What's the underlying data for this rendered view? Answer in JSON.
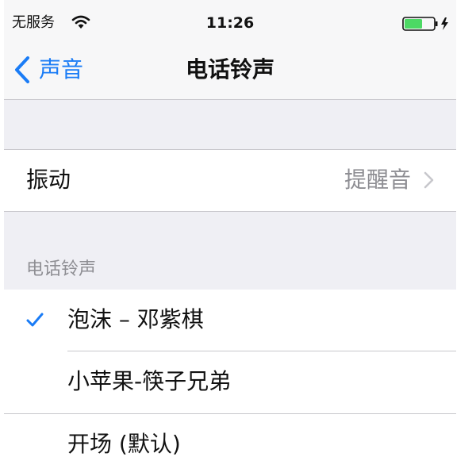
{
  "status_bar": {
    "carrier": "无服务",
    "time": "11:26",
    "icons": [
      "wifi-icon",
      "battery-charging-icon"
    ],
    "battery_color": "#4cd964"
  },
  "nav": {
    "back_label": "声音",
    "title": "电话铃声",
    "accent_color": "#1a7cf6"
  },
  "settings": {
    "vibration": {
      "label": "振动",
      "value": "提醒音"
    }
  },
  "ringtones": {
    "header": "电话铃声",
    "items": [
      {
        "label": "泡沫 – 邓紫棋",
        "selected": true
      },
      {
        "label": "小苹果-筷子兄弟",
        "selected": false
      },
      {
        "label": "开场 (默认)",
        "selected": false
      }
    ]
  }
}
